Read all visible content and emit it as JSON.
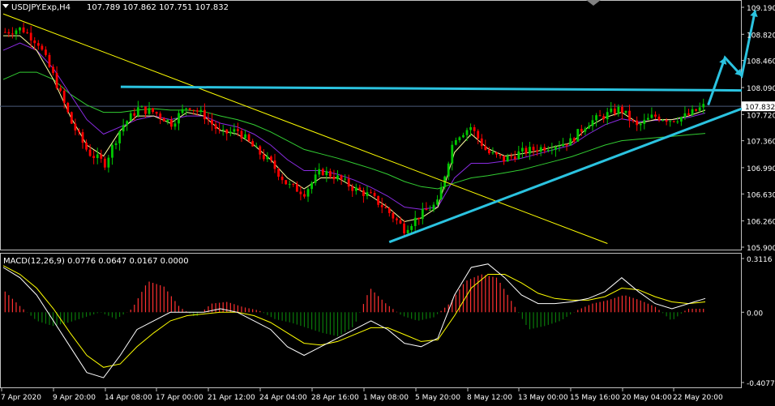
{
  "price_header": {
    "symbol": "USDJPY.Exp,H4",
    "ohlc": "107.789 107.862 107.751 107.832"
  },
  "macd_header": {
    "label": "MACD(12,26,9) 0.0776 0.0647 0.0167 0.0000"
  },
  "colors": {
    "background": "#000000",
    "grid_frame": "#c0c0c0",
    "text": "#ffffff",
    "bull_candle": "#00c800",
    "bear_candle": "#ff0000",
    "trendline_down": "#ffff00",
    "trendline_cyan": "#2bc3e0",
    "ma_fast": "#ffffa0",
    "ma_mid": "#8a2be2",
    "ma_slow": "#32cd32",
    "macd_line": "#ffffff",
    "signal_line": "#ffff00",
    "hist_pos": "#ff3030",
    "hist_neg": "#0a7a0a",
    "current_price_box": "#ffffff"
  },
  "chart_data": [
    {
      "type": "candlestick",
      "title": "USDJPY.Exp,H4",
      "current_price": 107.832,
      "ylim": [
        105.9,
        109.19
      ],
      "y_ticks": [
        "109.190",
        "108.820",
        "108.460",
        "108.090",
        "107.720",
        "107.360",
        "106.990",
        "106.630",
        "106.260",
        "105.900"
      ],
      "x_ticks": [
        "7 Apr 2020",
        "9 Apr 20:00",
        "14 Apr 08:00",
        "17 Apr 00:00",
        "21 Apr 12:00",
        "24 Apr 04:00",
        "28 Apr 16:00",
        "1 May 08:00",
        "5 May 20:00",
        "8 May 12:00",
        "13 May 00:00",
        "15 May 16:00",
        "20 May 04:00",
        "22 May 20:00"
      ],
      "close_path_approx": [
        108.85,
        108.9,
        108.7,
        108.2,
        107.6,
        107.2,
        107.05,
        107.55,
        107.8,
        107.75,
        107.6,
        107.85,
        107.7,
        107.45,
        107.5,
        107.25,
        107.05,
        106.75,
        106.65,
        106.95,
        106.85,
        106.7,
        106.6,
        106.4,
        106.15,
        106.35,
        106.5,
        107.4,
        107.55,
        107.2,
        107.1,
        107.2,
        107.25,
        107.3,
        107.35,
        107.6,
        107.7,
        107.8,
        107.55,
        107.7,
        107.65,
        107.7,
        107.83
      ],
      "moving_average_fast": [
        108.8,
        108.8,
        108.6,
        108.2,
        107.7,
        107.3,
        107.15,
        107.5,
        107.7,
        107.7,
        107.6,
        107.75,
        107.7,
        107.5,
        107.45,
        107.3,
        107.1,
        106.85,
        106.7,
        106.85,
        106.85,
        106.72,
        106.6,
        106.45,
        106.25,
        106.3,
        106.45,
        107.2,
        107.45,
        107.25,
        107.15,
        107.18,
        107.22,
        107.28,
        107.33,
        107.55,
        107.68,
        107.75,
        107.6,
        107.65,
        107.65,
        107.7,
        107.78
      ],
      "moving_average_mid": [
        108.6,
        108.7,
        108.6,
        108.35,
        108.0,
        107.65,
        107.45,
        107.55,
        107.65,
        107.7,
        107.65,
        107.7,
        107.7,
        107.6,
        107.55,
        107.45,
        107.3,
        107.1,
        106.95,
        106.95,
        106.9,
        106.82,
        106.72,
        106.6,
        106.45,
        106.42,
        106.45,
        106.85,
        107.05,
        107.05,
        107.08,
        107.12,
        107.18,
        107.24,
        107.3,
        107.45,
        107.58,
        107.66,
        107.62,
        107.64,
        107.65,
        107.68,
        107.74
      ],
      "moving_average_slow": [
        108.2,
        108.3,
        108.3,
        108.2,
        108.0,
        107.85,
        107.75,
        107.75,
        107.78,
        107.8,
        107.78,
        107.78,
        107.76,
        107.7,
        107.65,
        107.58,
        107.48,
        107.36,
        107.24,
        107.18,
        107.12,
        107.05,
        106.98,
        106.9,
        106.8,
        106.73,
        106.7,
        106.78,
        106.85,
        106.88,
        106.92,
        106.96,
        107.02,
        107.08,
        107.14,
        107.22,
        107.3,
        107.36,
        107.38,
        107.4,
        107.42,
        107.44,
        107.46
      ],
      "trendlines": [
        {
          "name": "descending yellow line",
          "from": [
            0,
            109.1
          ],
          "to": [
            36,
            105.95
          ]
        },
        {
          "name": "horizontal cyan resistance",
          "from": [
            7,
            108.1
          ],
          "to": [
            44,
            108.05
          ]
        },
        {
          "name": "ascending cyan support",
          "from": [
            23,
            105.97
          ],
          "to": [
            44,
            107.8
          ]
        }
      ],
      "projection_arrow": [
        [
          42,
          107.85
        ],
        [
          43,
          108.5
        ],
        [
          44,
          108.25
        ],
        [
          44.8,
          109.15
        ]
      ]
    },
    {
      "type": "bar",
      "title": "MACD(12,26,9) 0.0776 0.0647 0.0167 0.0000",
      "ylim": [
        -0.4077,
        0.3116
      ],
      "y_ticks": [
        "0.3116",
        "0.00",
        "-0.4077"
      ],
      "histogram": [
        0.12,
        0.03,
        -0.05,
        -0.08,
        -0.06,
        -0.03,
        0.0,
        -0.04,
        0.02,
        0.18,
        0.15,
        0.03,
        -0.03,
        0.05,
        0.06,
        0.03,
        0.01,
        -0.04,
        -0.06,
        -0.09,
        -0.12,
        -0.14,
        -0.08,
        0.14,
        0.05,
        -0.02,
        -0.05,
        -0.03,
        0.05,
        0.18,
        0.22,
        0.2,
        0.05,
        -0.1,
        -0.08,
        -0.05,
        0.01,
        0.05,
        0.07,
        0.1,
        0.07,
        0.03,
        -0.05,
        0.02,
        0.02
      ],
      "macd_line": [
        0.26,
        0.2,
        0.1,
        -0.05,
        -0.2,
        -0.35,
        -0.38,
        -0.25,
        -0.1,
        -0.05,
        0.0,
        0.0,
        0.0,
        0.02,
        0.0,
        -0.05,
        -0.1,
        -0.2,
        -0.25,
        -0.2,
        -0.15,
        -0.1,
        -0.05,
        -0.1,
        -0.18,
        -0.2,
        -0.15,
        0.1,
        0.26,
        0.28,
        0.2,
        0.1,
        0.05,
        0.05,
        0.06,
        0.08,
        0.12,
        0.2,
        0.12,
        0.05,
        0.02,
        0.05,
        0.08
      ],
      "signal_line": [
        0.27,
        0.22,
        0.14,
        0.02,
        -0.12,
        -0.25,
        -0.32,
        -0.3,
        -0.2,
        -0.12,
        -0.05,
        -0.02,
        -0.01,
        0.0,
        0.0,
        -0.02,
        -0.06,
        -0.12,
        -0.18,
        -0.19,
        -0.17,
        -0.13,
        -0.09,
        -0.09,
        -0.13,
        -0.17,
        -0.16,
        -0.02,
        0.14,
        0.22,
        0.22,
        0.17,
        0.11,
        0.08,
        0.07,
        0.07,
        0.09,
        0.14,
        0.13,
        0.09,
        0.06,
        0.05,
        0.06
      ]
    }
  ]
}
